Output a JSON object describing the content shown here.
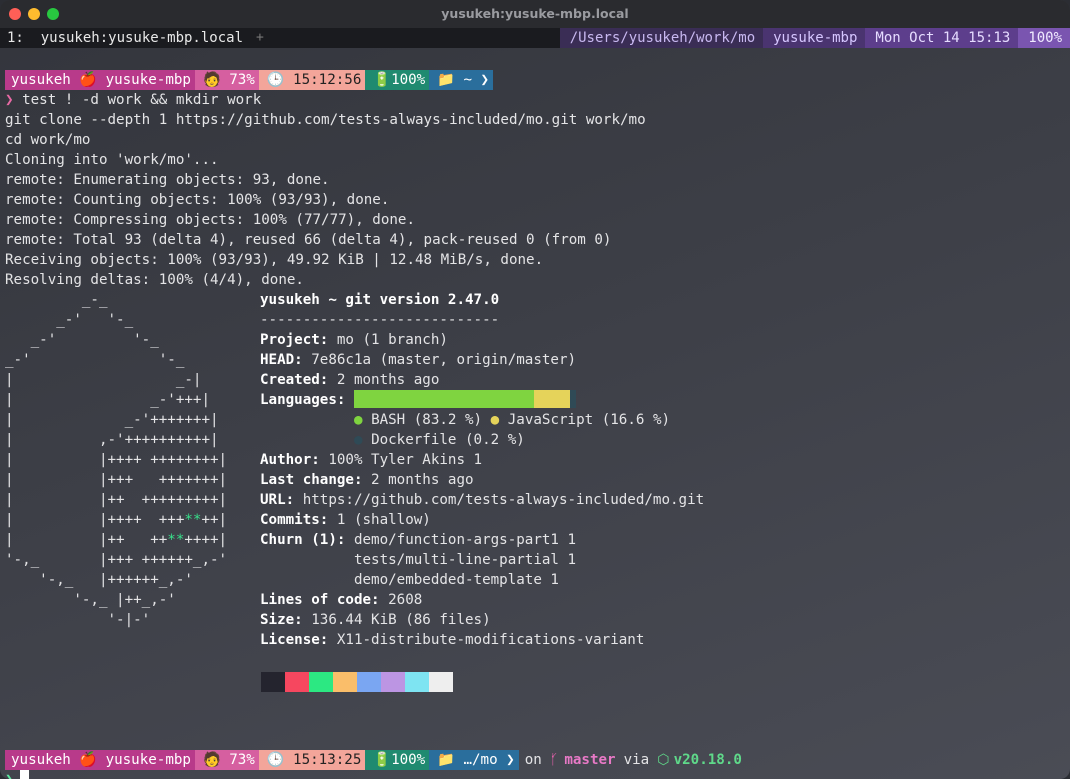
{
  "window": {
    "title": "yusukeh:yusuke-mbp.local"
  },
  "tmux": {
    "window_index": "1:",
    "window_name": "yusukeh:yusuke-mbp.local",
    "new_tab": "+",
    "path": "/Users/yusukeh/work/mo",
    "host": "yusuke-mbp",
    "datetime": "Mon Oct 14 15:13",
    "percent": "100%"
  },
  "prompt1": {
    "user": "yusukeh",
    "host": "yusuke-mbp",
    "cpu": "73%",
    "time": "15:12:56",
    "battery": "100%",
    "dir": "~"
  },
  "commands": [
    "test ! -d work && mkdir work",
    "git clone --depth 1 https://github.com/tests-always-included/mo.git work/mo",
    "cd work/mo"
  ],
  "output": [
    "Cloning into 'work/mo'...",
    "remote: Enumerating objects: 93, done.",
    "remote: Counting objects: 100% (93/93), done.",
    "remote: Compressing objects: 100% (77/77), done.",
    "remote: Total 93 (delta 4), reused 66 (delta 4), pack-reused 0 (from 0)",
    "Receiving objects: 100% (93/93), 49.92 KiB | 12.48 MiB/s, done.",
    "Resolving deltas: 100% (4/4), done."
  ],
  "ascii_art": [
    "         _-_",
    "      _-'   '-_",
    "   _-'         '-_",
    "_-'               '-_",
    "|                   _-|",
    "|                _-'+++|",
    "|             _-'+++++++|",
    "|          ,-'++++++++++|",
    "|          |++++ ++++++++|",
    "|          |+++   +++++++|",
    "|          |++  +++++++++|",
    "|          |++++  +++",
    "|          |++   ++",
    "'-,_       |+++ ++++++_,-'",
    "    '-,_   |++++++_,-'",
    "        '-,_ |++_,-'",
    "            '-|-'"
  ],
  "ascii_star_lines": {
    "l11_after": "++|",
    "l12_after": "++++|",
    "star": "**"
  },
  "fetch": {
    "header": "yusukeh ~ git version 2.47.0",
    "divider": "----------------------------",
    "project_key": "Project:",
    "project_val": "mo (1 branch)",
    "head_key": "HEAD:",
    "head_val": "7e86c1a (master, origin/master)",
    "created_key": "Created:",
    "created_val": "2 months ago",
    "languages_key": "Languages:",
    "lang_bash": "BASH (83.2 %)",
    "lang_js": "JavaScript (16.6 %)",
    "lang_docker": "Dockerfile (0.2 %)",
    "lang_fractions": {
      "bash": 0.832,
      "javascript": 0.166,
      "dockerfile": 0.002
    },
    "author_key": "Author:",
    "author_val": "100% Tyler Akins 1",
    "lastchange_key": "Last change:",
    "lastchange_val": "2 months ago",
    "url_key": "URL:",
    "url_val": "https://github.com/tests-always-included/mo.git",
    "commits_key": "Commits:",
    "commits_val": "1 (shallow)",
    "churn_key": "Churn (1):",
    "churn": [
      "demo/function-args-part1 1",
      "tests/multi-line-partial 1",
      "demo/embedded-template 1"
    ],
    "loc_key": "Lines of code:",
    "loc_val": "2608",
    "size_key": "Size:",
    "size_val": "136.44 KiB (86 files)",
    "license_key": "License:",
    "license_val": "X11-distribute-modifications-variant"
  },
  "palette": [
    "#24242e",
    "#f6475f",
    "#2ce882",
    "#fabe6a",
    "#7aa6f2",
    "#bc95e3",
    "#7ee4f2",
    "#eeeeee"
  ],
  "prompt2": {
    "user": "yusukeh",
    "host": "yusuke-mbp",
    "cpu": "73%",
    "time": "15:13:25",
    "battery": "100%",
    "dir": "…/mo",
    "on": "on",
    "branch": "master",
    "via": "via",
    "node": "v20.18.0"
  },
  "colors": {
    "user_segment": "#b83a8a",
    "accent": "#e86aa5",
    "node": "#5fd98a"
  }
}
